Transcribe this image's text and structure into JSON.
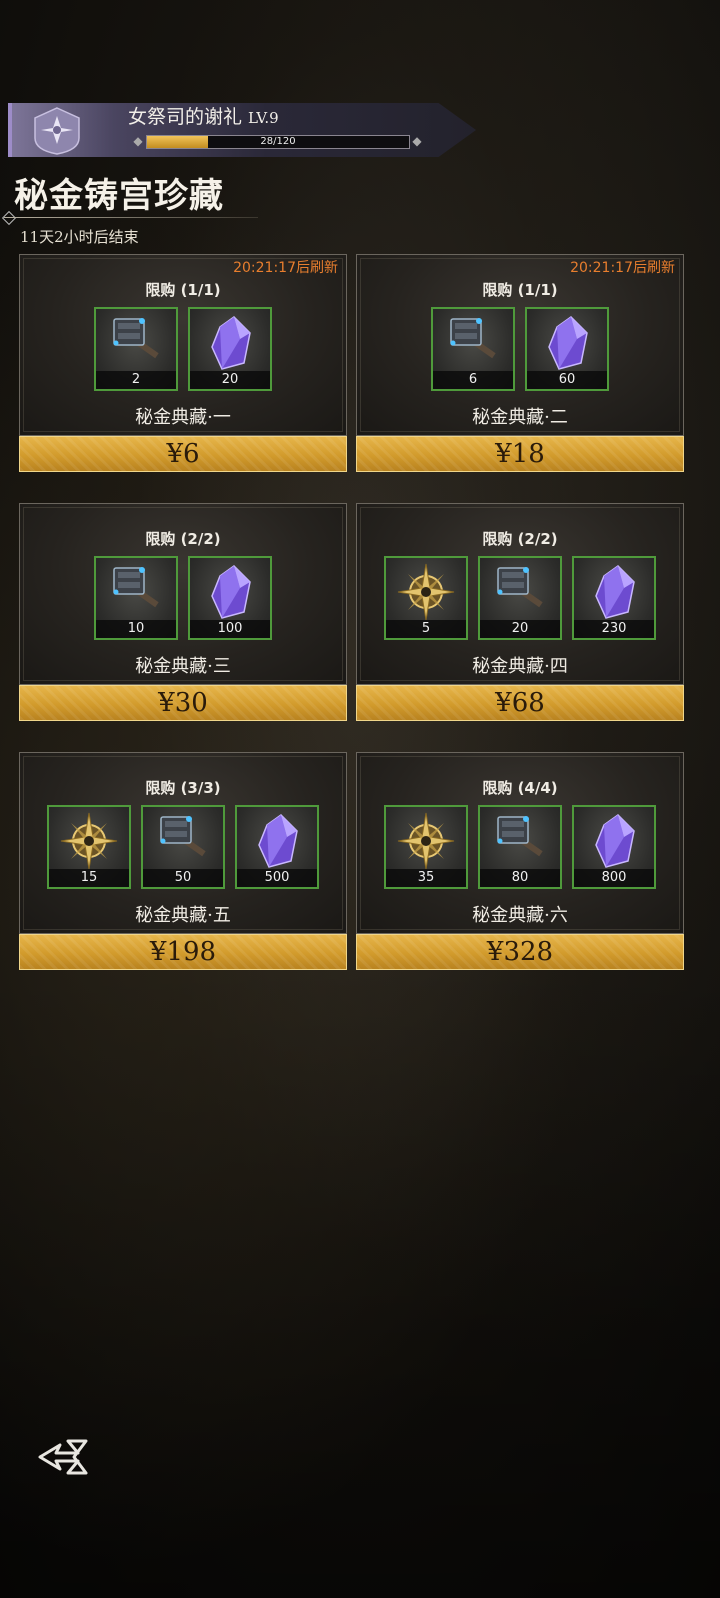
{
  "banner": {
    "title": "女祭司的谢礼",
    "level": "LV.9",
    "xp_text": "28/120",
    "xp_progress": 0.2333,
    "emblem_icon": "priestess-emblem-icon"
  },
  "page": {
    "title": "秘金铸宫珍藏",
    "timer": "11天2小时后结束"
  },
  "packs": [
    {
      "refresh": "20:21:17后刷新",
      "limit": "限购 (1/1)",
      "items": [
        {
          "icon": "hammer-icon",
          "count": "2"
        },
        {
          "icon": "purple-crystal-icon",
          "count": "20"
        }
      ],
      "name": "秘金典藏·一",
      "price": "¥6"
    },
    {
      "refresh": "20:21:17后刷新",
      "limit": "限购 (1/1)",
      "items": [
        {
          "icon": "hammer-icon",
          "count": "6"
        },
        {
          "icon": "purple-crystal-icon",
          "count": "60"
        }
      ],
      "name": "秘金典藏·二",
      "price": "¥18"
    },
    {
      "refresh": "",
      "limit": "限购 (2/2)",
      "items": [
        {
          "icon": "hammer-icon",
          "count": "10"
        },
        {
          "icon": "purple-crystal-icon",
          "count": "100"
        }
      ],
      "name": "秘金典藏·三",
      "price": "¥30"
    },
    {
      "refresh": "",
      "limit": "限购 (2/2)",
      "items": [
        {
          "icon": "golden-compass-icon",
          "count": "5"
        },
        {
          "icon": "hammer-icon",
          "count": "20"
        },
        {
          "icon": "purple-crystal-icon",
          "count": "230"
        }
      ],
      "name": "秘金典藏·四",
      "price": "¥68"
    },
    {
      "refresh": "",
      "limit": "限购 (3/3)",
      "items": [
        {
          "icon": "golden-compass-icon",
          "count": "15"
        },
        {
          "icon": "hammer-icon",
          "count": "50"
        },
        {
          "icon": "purple-crystal-icon",
          "count": "500"
        }
      ],
      "name": "秘金典藏·五",
      "price": "¥198"
    },
    {
      "refresh": "",
      "limit": "限购 (4/4)",
      "items": [
        {
          "icon": "golden-compass-icon",
          "count": "35"
        },
        {
          "icon": "hammer-icon",
          "count": "80"
        },
        {
          "icon": "purple-crystal-icon",
          "count": "800"
        }
      ],
      "name": "秘金典藏·六",
      "price": "¥328"
    }
  ],
  "nav": {
    "back_icon": "back-arrow-icon"
  },
  "colors": {
    "accent_gold": "#d9a736",
    "refresh_orange": "#e87e2e",
    "item_border_green": "#4f9a3b"
  }
}
